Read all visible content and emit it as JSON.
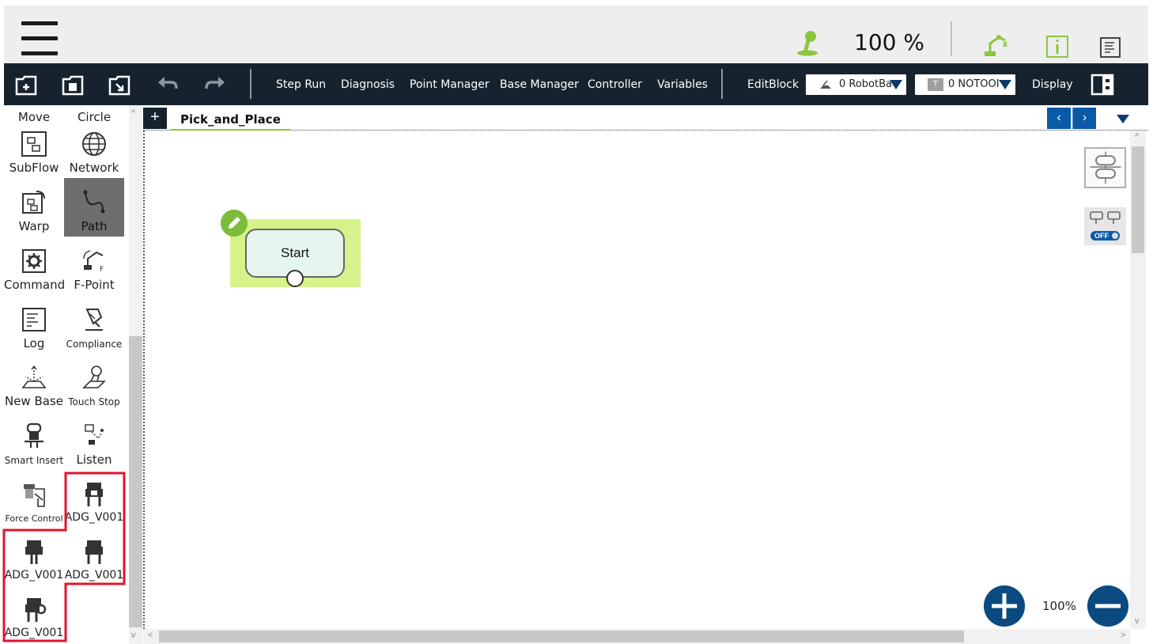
{
  "status_bar": {
    "speed_value": "100 %",
    "icons": [
      "menu-icon",
      "speed-joystick-icon",
      "robot-status-icon",
      "info-icon",
      "notes-icon"
    ]
  },
  "toolbar": {
    "menus": {
      "step_run": "Step Run",
      "diagnosis": "Diagnosis",
      "point_manager": "Point Manager",
      "base_manager": "Base Manager",
      "controller": "Controller",
      "variables": "Variables",
      "edit_block": "EditBlock",
      "display": "Display"
    },
    "base_select": "0 RobotBa",
    "tool_select": "0 NOTOOI",
    "tool_badge": "T",
    "icons": [
      "new-project-icon",
      "save-project-icon",
      "open-project-icon",
      "undo-icon",
      "redo-icon",
      "display-layout-icon"
    ]
  },
  "palette": {
    "items": [
      {
        "label": "Move",
        "icon": "move-icon"
      },
      {
        "label": "Circle",
        "icon": "circle-icon"
      },
      {
        "label": "SubFlow",
        "icon": "subflow-icon"
      },
      {
        "label": "Network",
        "icon": "network-icon"
      },
      {
        "label": "Warp",
        "icon": "warp-icon"
      },
      {
        "label": "Path",
        "icon": "path-icon",
        "selected": true
      },
      {
        "label": "Command",
        "icon": "command-icon"
      },
      {
        "label": "F-Point",
        "icon": "f-point-icon"
      },
      {
        "label": "Log",
        "icon": "log-icon"
      },
      {
        "label": "Compliance",
        "icon": "compliance-icon"
      },
      {
        "label": "New Base",
        "icon": "new-base-icon"
      },
      {
        "label": "Touch Stop",
        "icon": "touch-stop-icon"
      },
      {
        "label": "Smart Insert",
        "icon": "smart-insert-icon"
      },
      {
        "label": "Listen",
        "icon": "listen-icon"
      },
      {
        "label": "Force Control",
        "icon": "force-control-icon"
      },
      {
        "label": "ADG_V001",
        "icon": "gripper-icon"
      },
      {
        "label": "ADG_V001",
        "icon": "gripper-icon"
      },
      {
        "label": "ADG_V001",
        "icon": "gripper-icon"
      },
      {
        "label": "ADG_V001",
        "icon": "gripper-settings-icon"
      }
    ]
  },
  "tabs": {
    "add_label": "+",
    "active": "Pick_and_Place",
    "prev": "‹",
    "next": "›"
  },
  "canvas": {
    "start_node": "Start",
    "zoom": "100%",
    "highlight_color": "#d6f28a",
    "toggle_state": "OFF"
  },
  "colors": {
    "toolbar_bg": "#16232f",
    "accent_blue": "#0b5aa7",
    "zoom_button": "#0a4a7f",
    "green": "#7dbb3c",
    "annotation_red": "#e0142c"
  }
}
